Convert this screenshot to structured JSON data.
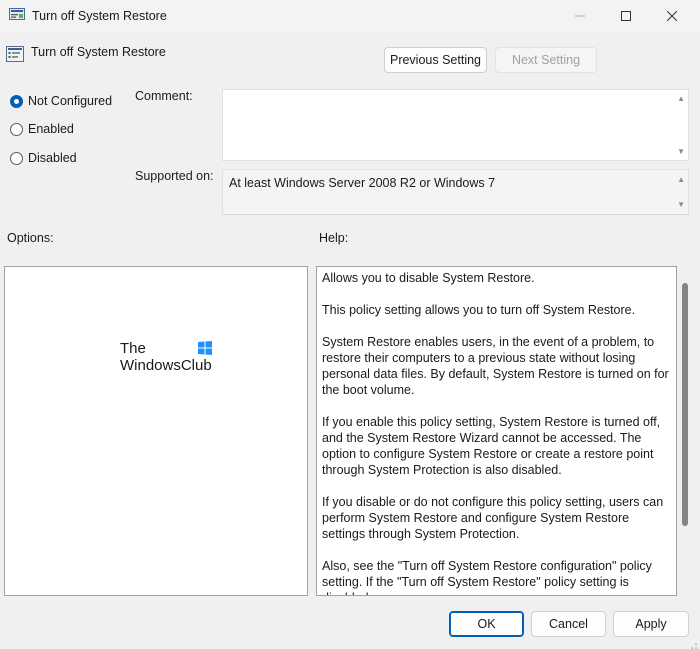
{
  "window": {
    "title": "Turn off System Restore",
    "icon": "policy-settings-icon"
  },
  "header": {
    "title": "Turn off System Restore",
    "icon": "policy-setting-icon"
  },
  "nav": {
    "previous_label": "Previous Setting",
    "next_label": "Next Setting"
  },
  "state_options": [
    {
      "label": "Not Configured",
      "checked": true
    },
    {
      "label": "Enabled",
      "checked": false
    },
    {
      "label": "Disabled",
      "checked": false
    }
  ],
  "comment": {
    "label": "Comment:",
    "value": ""
  },
  "supported_on": {
    "label": "Supported on:",
    "value": "At least Windows Server 2008 R2 or Windows 7"
  },
  "options": {
    "label": "Options:",
    "logo_line1": "The",
    "logo_line2": "WindowsClub"
  },
  "help": {
    "label": "Help:",
    "paragraphs": [
      "Allows you to disable System Restore.",
      "This policy setting allows you to turn off System Restore.",
      "System Restore enables users, in the event of a problem, to restore their computers to a previous state without losing personal data files. By default, System Restore is turned on for the boot volume.",
      "If you enable this policy setting, System Restore is turned off, and the System Restore Wizard cannot be accessed. The option to configure System Restore or create a restore point through System Protection is also disabled.",
      "If you disable or do not configure this policy setting, users can perform System Restore and configure System Restore settings through System Protection.",
      "Also, see the \"Turn off System Restore configuration\" policy setting. If the \"Turn off System Restore\" policy setting is disabled"
    ]
  },
  "footer": {
    "ok_label": "OK",
    "cancel_label": "Cancel",
    "apply_label": "Apply"
  },
  "colors": {
    "accent": "#005fb8",
    "background": "#f0f0f0"
  }
}
